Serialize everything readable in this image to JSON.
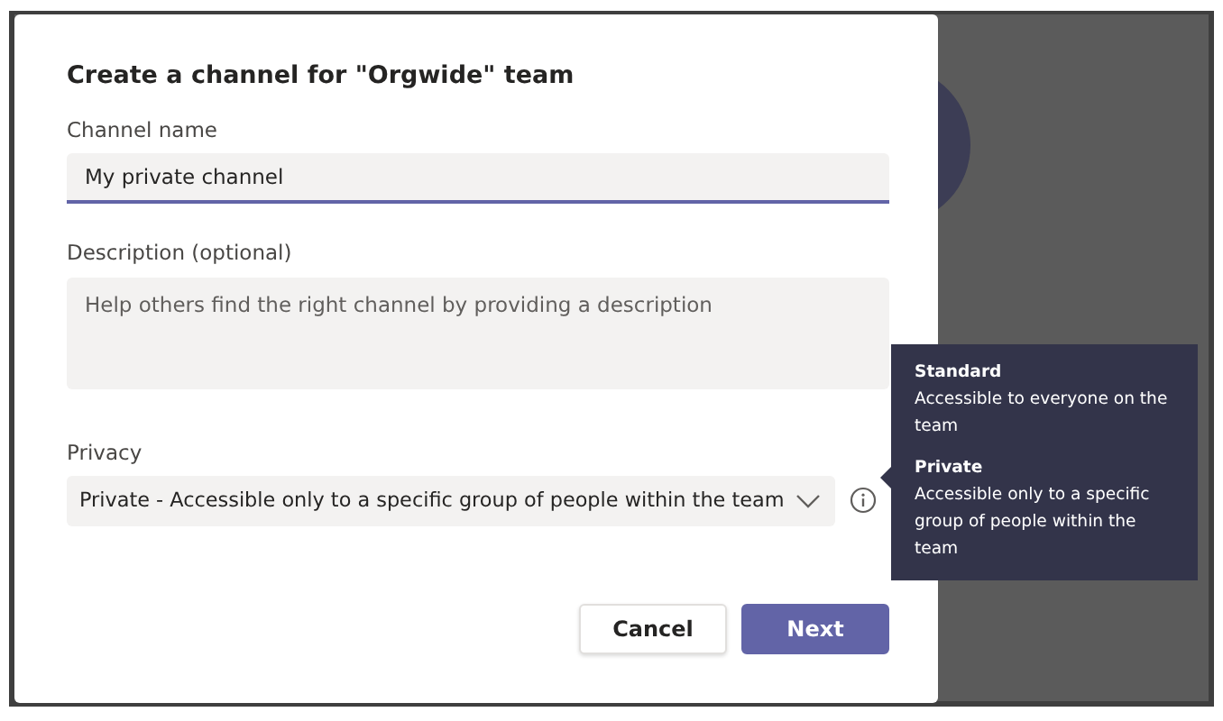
{
  "dialog": {
    "title": "Create a channel for \"Orgwide\" team",
    "fields": [
      {
        "kind": "input",
        "label": "Channel name",
        "value": "My private channel",
        "focused": true
      },
      {
        "kind": "textarea",
        "label": "Description (optional)",
        "placeholder": "Help others find the right channel by providing a description"
      },
      {
        "kind": "select",
        "label": "Privacy",
        "value": "Private - Accessible only to a specific group of people within the team"
      }
    ],
    "buttons": [
      {
        "label": "Cancel",
        "kind": "secondary"
      },
      {
        "label": "Next",
        "kind": "primary"
      }
    ]
  },
  "tooltip": {
    "entries": [
      {
        "title": "Standard",
        "text": "Accessible to everyone on the team"
      },
      {
        "title": "Private",
        "text": "Accessible only to a specific group of people within the team"
      }
    ]
  }
}
